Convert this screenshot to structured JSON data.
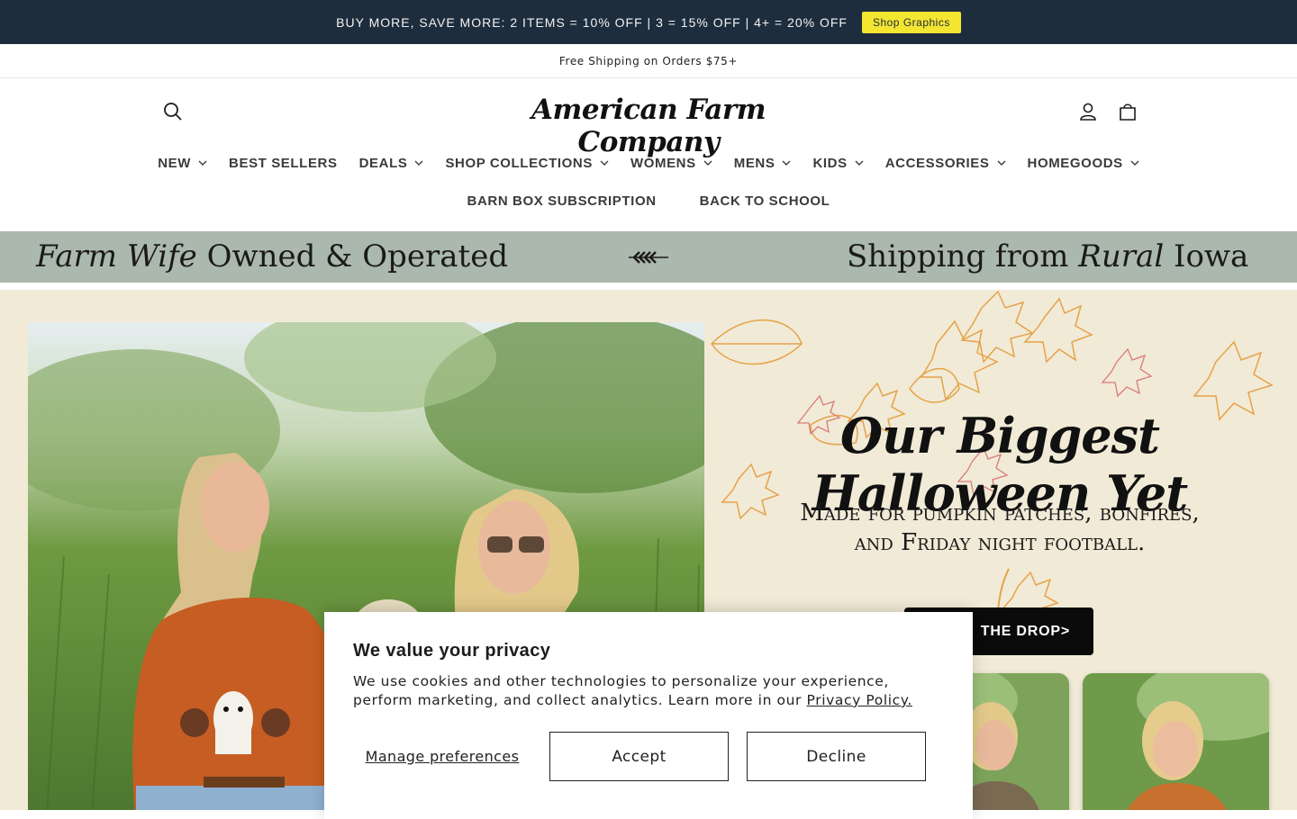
{
  "promo": {
    "text": "BUY MORE, SAVE MORE: 2 ITEMS = 10% OFF | 3 = 15% OFF | 4+ = 20% OFF",
    "button": "Shop Graphics"
  },
  "shipping_bar": "Free Shipping on Orders $75+",
  "header": {
    "logo": "American Farm Company",
    "icons": [
      "search-icon",
      "account-icon",
      "cart-icon"
    ]
  },
  "nav": {
    "row1": [
      {
        "label": "NEW",
        "dropdown": true
      },
      {
        "label": "BEST SELLERS",
        "dropdown": false
      },
      {
        "label": "DEALS",
        "dropdown": true
      },
      {
        "label": "SHOP COLLECTIONS",
        "dropdown": true
      },
      {
        "label": "WOMENS",
        "dropdown": true
      },
      {
        "label": "MENS",
        "dropdown": true
      },
      {
        "label": "KIDS",
        "dropdown": true
      },
      {
        "label": "ACCESSORIES",
        "dropdown": true
      },
      {
        "label": "HOMEGOODS",
        "dropdown": true
      }
    ],
    "row2": [
      {
        "label": "BARN BOX SUBSCRIPTION",
        "dropdown": false
      },
      {
        "label": "BACK TO SCHOOL",
        "dropdown": false
      }
    ]
  },
  "strip": {
    "left_italic": "Farm Wife",
    "left_rest": "Owned & Operated",
    "right_start": "Shipping from",
    "right_italic": "Rural",
    "right_end": "Iowa"
  },
  "hero": {
    "title": "Our Biggest Halloween Yet",
    "subtitle_line1": "Made for pumpkin patches, bonfires,",
    "subtitle_line2": "and Friday night football.",
    "cta": "THE DROP>"
  },
  "privacy": {
    "title": "We value your privacy",
    "body": "We use cookies and other technologies to personalize your experience, perform marketing, and collect analytics. Learn more in our ",
    "link": "Privacy Policy.",
    "manage": "Manage preferences",
    "accept": "Accept",
    "decline": "Decline"
  },
  "colors": {
    "promo_bg": "#1e2d3d",
    "promo_button": "#f4e531",
    "strip_bg": "#abb8ae",
    "hero_bg": "#f1ead6"
  }
}
